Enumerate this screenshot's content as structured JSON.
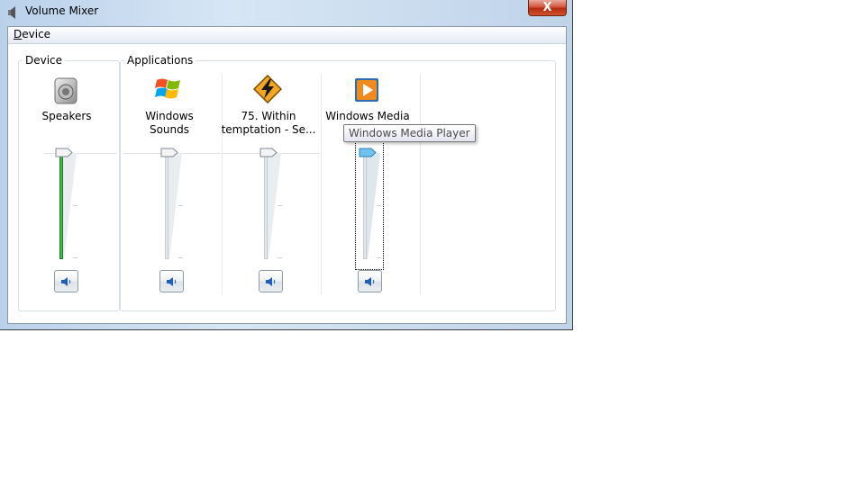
{
  "window": {
    "title": "Volume Mixer",
    "close_glyph": "X"
  },
  "menu": {
    "device": "Device"
  },
  "groups": {
    "device_label": "Device",
    "applications_label": "Applications"
  },
  "channels": [
    {
      "name_line1": "Speakers",
      "name_line2": "",
      "icon": "speaker-icon",
      "volume_fraction": 1.0
    },
    {
      "name_line1": "Windows",
      "name_line2": "Sounds",
      "icon": "windows-flag-icon",
      "volume_fraction": 1.0
    },
    {
      "name_line1": "75. Within",
      "name_line2": "temptation - Se...",
      "icon": "winamp-icon",
      "volume_fraction": 1.0
    },
    {
      "name_line1": "Windows Media",
      "name_line2": "",
      "icon": "windows-media-player-icon",
      "volume_fraction": 1.0
    }
  ],
  "tooltip": {
    "text": "Windows Media Player"
  },
  "colors": {
    "level_fill": "#3ab54a",
    "close_button": "#c8432a",
    "thumb_focused": "#6fc3f0"
  }
}
